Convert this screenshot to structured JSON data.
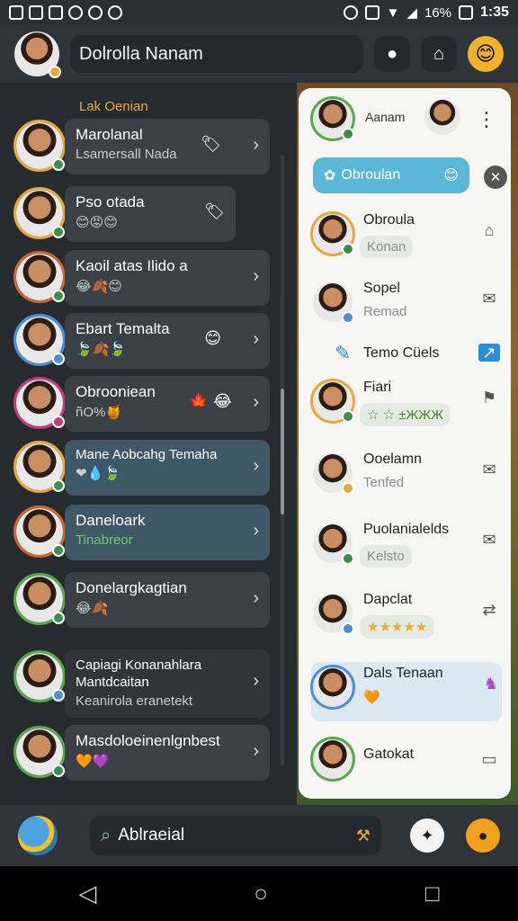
{
  "status_bar": {
    "battery": "16%",
    "time": "1:35"
  },
  "app_bar": {
    "title": "Dolrolla Nanam"
  },
  "left_list": {
    "section_label": "Lak Oenian",
    "items": [
      {
        "title": "Marolanal",
        "subtitle": "Lsamersall Nada",
        "tail": "🏷"
      },
      {
        "title": "Pso otada",
        "subtitle": "😊😡😊",
        "tail": "🏷"
      },
      {
        "title": "Kaoil atas Ilido a",
        "subtitle": "😂🍂😊",
        "tail": ""
      },
      {
        "title": "Ebart Temalta",
        "subtitle": "🍃🍂🍃",
        "tail": "😊"
      },
      {
        "title": "Obrooniean",
        "subtitle": "ñO%🍯",
        "tail": "🍁 😂"
      },
      {
        "title": "Mane Aobcahg Temaha",
        "subtitle": "❤💧🍃",
        "tail": ""
      },
      {
        "title": "Daneloark",
        "subtitle": "Tinabreor",
        "tail": ""
      },
      {
        "title": "Donelargkagtian",
        "subtitle": "😂🍂",
        "tail": ""
      },
      {
        "title": "Capiagi Konanahlara Mantdcaitan",
        "subtitle": "Keanirola eranetekt",
        "tail": ""
      },
      {
        "title": "Masdoloeinenlgnbest",
        "subtitle": "🧡💜",
        "tail": ""
      }
    ]
  },
  "contact_panel": {
    "header_name": "Aanam",
    "pill_label": "Obroulan",
    "contacts": [
      {
        "name": "Obroula",
        "sub": "Konan"
      },
      {
        "name": "Sopel",
        "sub": "Remad"
      },
      {
        "name": "Temo Cüels",
        "sub": ""
      },
      {
        "name": "Fiari",
        "sub": "☆ ☆ ±ЖЖЖ"
      },
      {
        "name": "Ooelamn",
        "sub": "Tenfed"
      },
      {
        "name": "Puolanialelds",
        "sub": "Kelsto"
      },
      {
        "name": "Dapclat",
        "sub": "★★★★★"
      },
      {
        "name": "Dals Tenaan",
        "sub": "🧡"
      },
      {
        "name": "Gatokat",
        "sub": ""
      }
    ]
  },
  "bottom_bar": {
    "search_text": "Ablraeial"
  }
}
